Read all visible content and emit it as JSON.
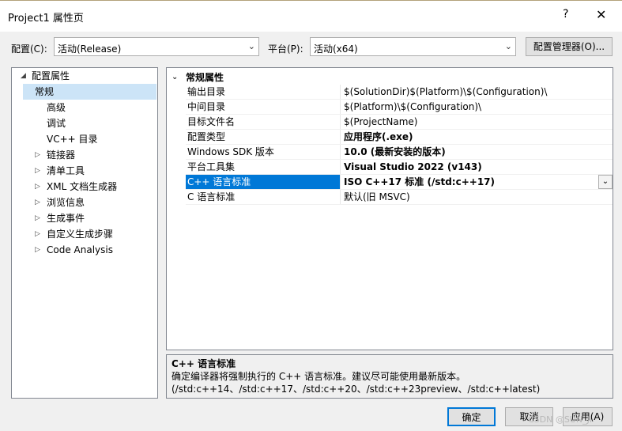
{
  "window": {
    "title": "Project1 属性页",
    "help": "?",
    "close": "✕"
  },
  "config": {
    "label": "配置(C):",
    "value": "活动(Release)",
    "platform_label": "平台(P):",
    "platform_value": "活动(x64)",
    "manager_button": "配置管理器(O)..."
  },
  "tree": {
    "items": [
      {
        "label": "配置属性",
        "expander": "◢"
      },
      {
        "label": "常规"
      },
      {
        "label": "高级"
      },
      {
        "label": "调试"
      },
      {
        "label": "VC++ 目录"
      },
      {
        "label": "链接器",
        "expander": "▷"
      },
      {
        "label": "清单工具",
        "expander": "▷"
      },
      {
        "label": "XML 文档生成器",
        "expander": "▷"
      },
      {
        "label": "浏览信息",
        "expander": "▷"
      },
      {
        "label": "生成事件",
        "expander": "▷"
      },
      {
        "label": "自定义生成步骤",
        "expander": "▷"
      },
      {
        "label": "Code Analysis",
        "expander": "▷"
      }
    ]
  },
  "grid": {
    "category": "常规属性",
    "rows": [
      {
        "name": "输出目录",
        "value": "$(SolutionDir)$(Platform)\\$(Configuration)\\"
      },
      {
        "name": "中间目录",
        "value": "$(Platform)\\$(Configuration)\\"
      },
      {
        "name": "目标文件名",
        "value": "$(ProjectName)"
      },
      {
        "name": "配置类型",
        "value": "应用程序(.exe)"
      },
      {
        "name": "Windows SDK 版本",
        "value": "10.0 (最新安装的版本)"
      },
      {
        "name": "平台工具集",
        "value": "Visual Studio 2022 (v143)"
      },
      {
        "name": "C++ 语言标准",
        "value": "ISO C++17 标准 (/std:c++17)"
      },
      {
        "name": "C 语言标准",
        "value": "默认(旧 MSVC)"
      }
    ]
  },
  "description": {
    "title": "C++ 语言标准",
    "text": "确定编译器将强制执行的 C++ 语言标准。建议尽可能使用最新版本。(/std:c++14、/std:c++17、/std:c++20、/std:c++23preview、/std:c++latest)"
  },
  "buttons": {
    "ok": "确定",
    "cancel": "取消",
    "apply": "应用(A)"
  },
  "watermark": "CSDN @SUN_JI",
  "colors": {
    "selection": "#0078d7",
    "tree_selection": "#cce4f7"
  }
}
